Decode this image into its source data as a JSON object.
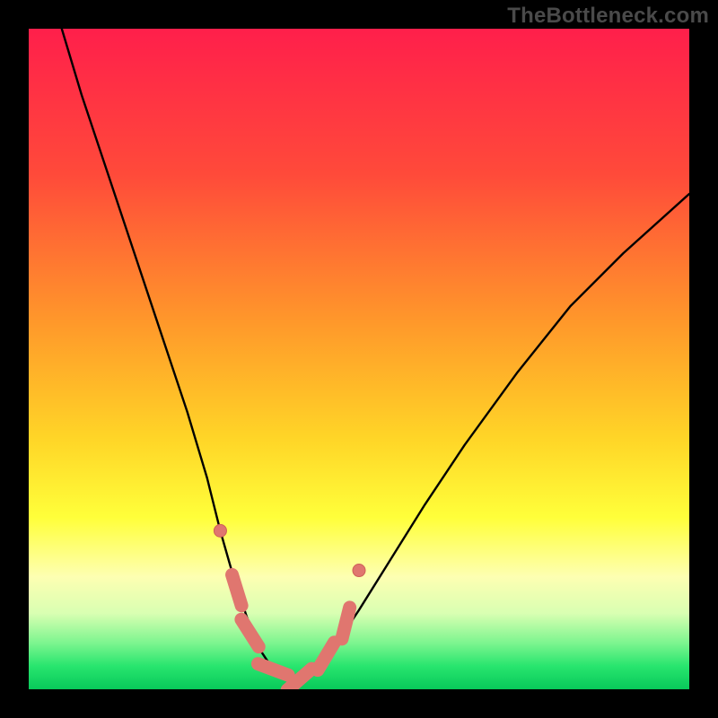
{
  "watermark": "TheBottleneck.com",
  "colors": {
    "frame": "#000000",
    "gradient_stops": [
      {
        "offset": 0.0,
        "color": "#ff1f4b"
      },
      {
        "offset": 0.22,
        "color": "#ff4a3a"
      },
      {
        "offset": 0.45,
        "color": "#ff9a2a"
      },
      {
        "offset": 0.62,
        "color": "#ffd527"
      },
      {
        "offset": 0.74,
        "color": "#ffff3a"
      },
      {
        "offset": 0.83,
        "color": "#fdffb2"
      },
      {
        "offset": 0.885,
        "color": "#d9ffb2"
      },
      {
        "offset": 0.93,
        "color": "#7cf58f"
      },
      {
        "offset": 0.965,
        "color": "#28e56e"
      },
      {
        "offset": 1.0,
        "color": "#08c95a"
      }
    ],
    "curve": "#000000",
    "marker_fill": "#e0766f",
    "marker_stroke": "#cf5f57"
  },
  "chart_data": {
    "type": "line",
    "title": "",
    "xlabel": "",
    "ylabel": "",
    "xlim": [
      0,
      100
    ],
    "ylim": [
      0,
      100
    ],
    "grid": false,
    "legend": false,
    "series": [
      {
        "name": "bottleneck-curve",
        "x": [
          5,
          8,
          12,
          16,
          20,
          24,
          27,
          29,
          31,
          33,
          35,
          37,
          39,
          41,
          43,
          46,
          50,
          55,
          60,
          66,
          74,
          82,
          90,
          100
        ],
        "y": [
          100,
          90,
          78,
          66,
          54,
          42,
          32,
          24,
          17,
          11,
          6,
          3,
          1.5,
          1.5,
          3,
          6,
          12,
          20,
          28,
          37,
          48,
          58,
          66,
          75
        ]
      }
    ],
    "markers": [
      {
        "x": 29.0,
        "y": 24.0,
        "kind": "dot"
      },
      {
        "x": 31.5,
        "y": 15.0,
        "kind": "pill-end"
      },
      {
        "x": 33.5,
        "y": 8.5,
        "kind": "pill-end"
      },
      {
        "x": 37.0,
        "y": 3.0,
        "kind": "pill-end"
      },
      {
        "x": 41.0,
        "y": 1.5,
        "kind": "pill-end"
      },
      {
        "x": 45.0,
        "y": 5.0,
        "kind": "pill-end"
      },
      {
        "x": 48.0,
        "y": 10.0,
        "kind": "pill-end"
      },
      {
        "x": 50.0,
        "y": 18.0,
        "kind": "dot"
      }
    ],
    "notes": "Axis values are relative 0–100; the chart has no visible tick labels or axis titles."
  }
}
